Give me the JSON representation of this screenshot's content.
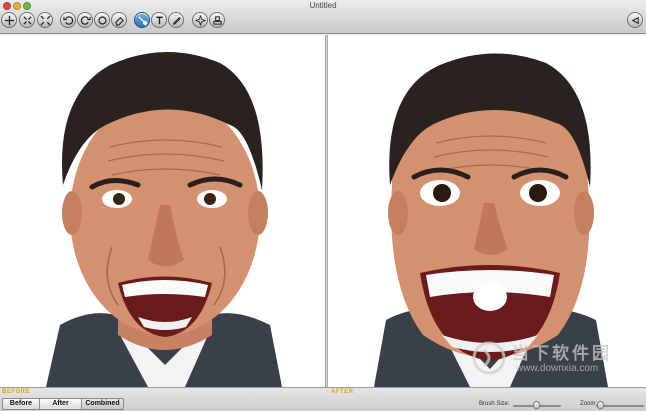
{
  "window": {
    "title": "Untitled"
  },
  "toolbar": {
    "tools": [
      {
        "name": "move-tool",
        "icon": "move-icon",
        "active": false
      },
      {
        "name": "bloat-tool",
        "icon": "expand-icon",
        "active": false
      },
      {
        "name": "pinch-tool",
        "icon": "shrink-icon",
        "active": false
      },
      {
        "name": "rotate-left-tool",
        "icon": "rotate-left-icon",
        "active": false
      },
      {
        "name": "rotate-right-tool",
        "icon": "rotate-right-icon",
        "active": false
      },
      {
        "name": "refresh-tool",
        "icon": "refresh-icon",
        "active": false
      },
      {
        "name": "erase-tool",
        "icon": "eraser-icon",
        "active": false
      },
      {
        "name": "warp-tool",
        "icon": "brush-icon",
        "active": true
      },
      {
        "name": "text-tool",
        "icon": "text-icon",
        "active": false
      },
      {
        "name": "pen-tool",
        "icon": "pen-icon",
        "active": false
      },
      {
        "name": "effects-tool",
        "icon": "sparkle-icon",
        "active": false
      },
      {
        "name": "stamp-tool",
        "icon": "stamp-icon",
        "active": false
      },
      {
        "name": "share-tool",
        "icon": "share-icon",
        "active": false
      }
    ]
  },
  "panes": {
    "before_label": "BEFORE",
    "after_label": "AFTER"
  },
  "watermark": {
    "title": "当下软件园",
    "url": "www.downxia.com"
  },
  "statusbar": {
    "buttons": [
      "Before",
      "After",
      "Combined"
    ],
    "selected_view": "Combined",
    "brush_size_label": "Brush Size:",
    "zoom_label": "Zoom:",
    "brush_size_level": 0.45,
    "zoom_level": 0.02
  },
  "colors": {
    "accent": "#2f6fae",
    "label": "#d9a21b"
  }
}
